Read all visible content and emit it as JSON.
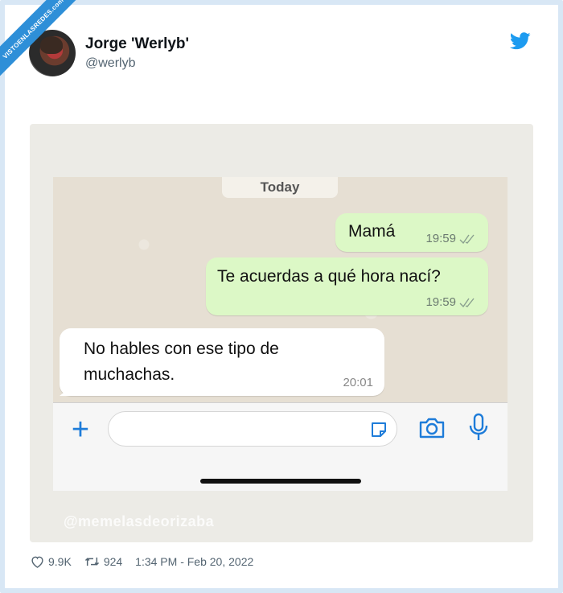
{
  "watermark_site": "VISTOENLASREDES.com",
  "tweet": {
    "author_name": "Jorge 'Werlyb'",
    "author_handle": "@werlyb",
    "likes": "9.9K",
    "retweets": "924",
    "timestamp": "1:34 PM - Feb 20, 2022"
  },
  "chat": {
    "date_label": "Today",
    "messages": [
      {
        "direction": "outgoing",
        "text": "Mamá",
        "time": "19:59"
      },
      {
        "direction": "outgoing",
        "text": "Te acuerdas a qué hora nací?",
        "time": "19:59"
      },
      {
        "direction": "incoming",
        "text": "No hables con ese tipo de muchachas.",
        "time": "20:01"
      }
    ],
    "input_placeholder": ""
  },
  "image_watermark": "@memelasdeorizaba",
  "icons": {
    "brand": "twitter-bird-icon",
    "like": "heart-icon",
    "retweet": "retweet-icon",
    "attach": "plus-icon",
    "sticker": "sticker-icon",
    "camera": "camera-icon",
    "mic": "microphone-icon"
  },
  "colors": {
    "twitter_blue": "#1d9bf0",
    "outgoing_bubble": "#dcf8c6",
    "incoming_bubble": "#ffffff",
    "whatsapp_accent": "#1e7cd9"
  }
}
